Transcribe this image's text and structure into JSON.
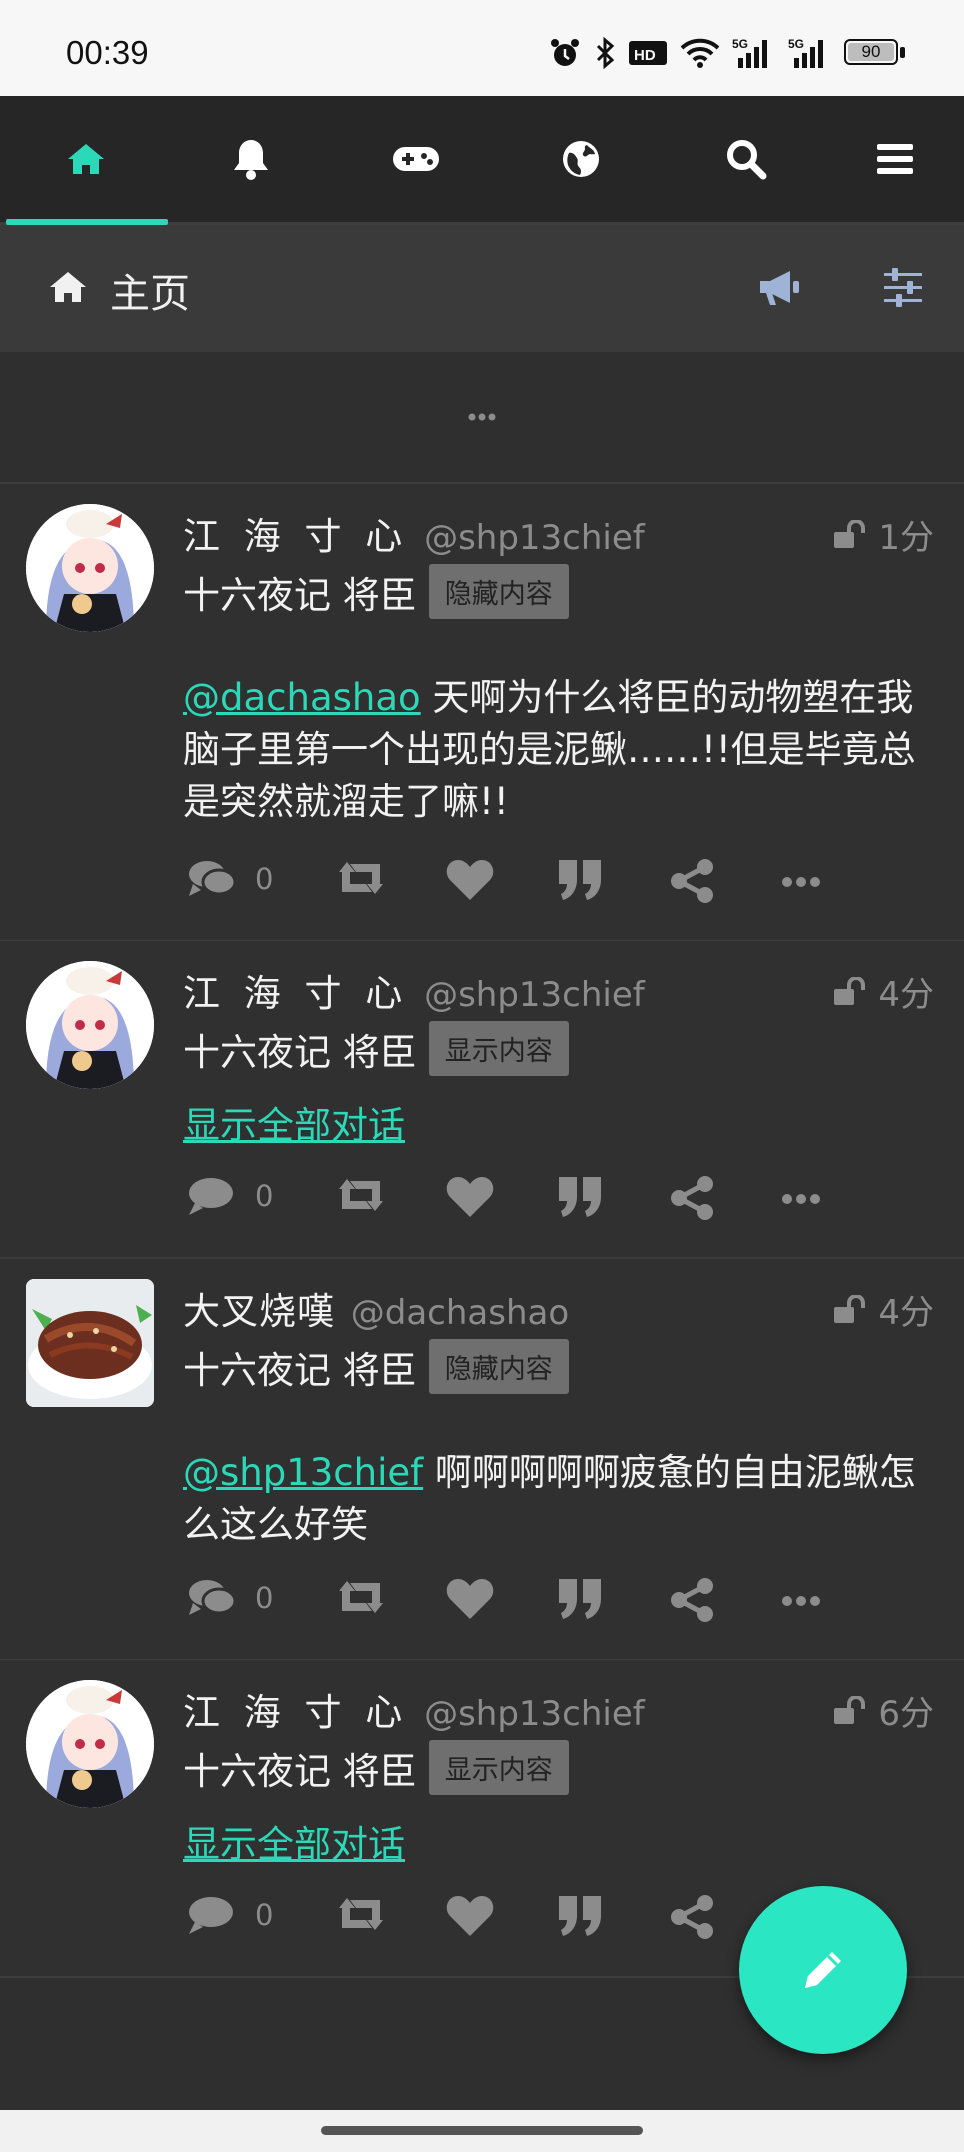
{
  "status_bar": {
    "time": "00:39",
    "battery": "90"
  },
  "nav": {
    "tabs": [
      {
        "id": "home",
        "icon": "home-icon",
        "active": true
      },
      {
        "id": "notifications",
        "icon": "bell-icon",
        "active": false
      },
      {
        "id": "games",
        "icon": "gamepad-icon",
        "active": false
      },
      {
        "id": "explore",
        "icon": "globe-icon",
        "active": false
      },
      {
        "id": "search",
        "icon": "search-icon",
        "active": false
      },
      {
        "id": "menu",
        "icon": "menu-icon",
        "active": false
      }
    ],
    "accent": "#2bd8b8"
  },
  "header": {
    "title": "主页",
    "icon": "home-icon",
    "buttons": [
      "megaphone-icon",
      "sliders-icon"
    ]
  },
  "load_more": {
    "icon": "ellipsis-icon"
  },
  "statuses": [
    {
      "display_name": "江 海 寸 心",
      "acct": "@shp13chief",
      "time": "1分",
      "visibility_icon": "unlock-icon",
      "cw": "十六夜记 将臣",
      "cw_button": "隐藏内容",
      "mention": "@dachashao",
      "content": " 天啊为什么将臣的动物塑在我脑子里第一个出现的是泥鳅……!!但是毕竟总是突然就溜走了嘛!!",
      "replies": "0"
    },
    {
      "display_name": "江 海 寸 心",
      "acct": "@shp13chief",
      "time": "4分",
      "visibility_icon": "unlock-icon",
      "cw": "十六夜记 将臣",
      "cw_button": "显示内容",
      "thread_link": "显示全部对话",
      "replies": "0"
    },
    {
      "display_name": "大叉烧嘆",
      "acct": "@dachashao",
      "time": "4分",
      "visibility_icon": "unlock-icon",
      "cw": "十六夜记 将臣",
      "cw_button": "隐藏内容",
      "mention": "@shp13chief",
      "content": " 啊啊啊啊啊疲惫的自由泥鳅怎么这么好笑",
      "replies": "0"
    },
    {
      "display_name": "江 海 寸 心",
      "acct": "@shp13chief",
      "time": "6分",
      "visibility_icon": "unlock-icon",
      "cw": "十六夜记 将臣",
      "cw_button": "显示内容",
      "thread_link": "显示全部对话",
      "replies": "0"
    }
  ],
  "actions": [
    "reply-icon",
    "boost-icon",
    "favourite-icon",
    "quote-icon",
    "share-icon",
    "more-icon"
  ],
  "fab": {
    "icon": "pencil-icon",
    "color": "#2be6c3"
  }
}
